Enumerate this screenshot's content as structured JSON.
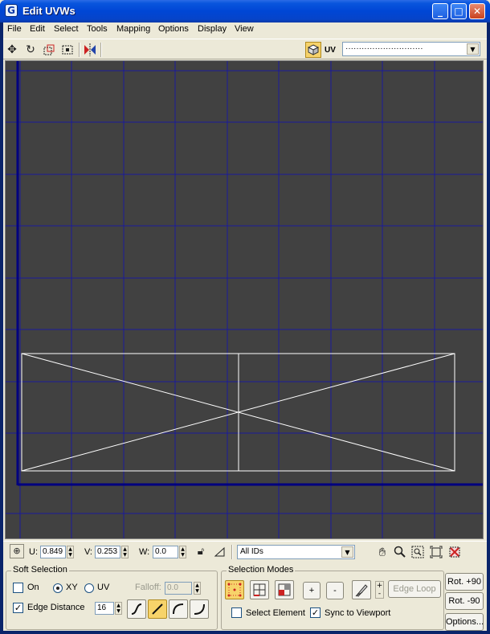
{
  "window": {
    "title": "Edit UVWs",
    "icon_letter": "G",
    "minimize_glyph": "_",
    "maximize_glyph": "□",
    "close_glyph": "✕"
  },
  "menu": {
    "items": [
      "File",
      "Edit",
      "Select",
      "Tools",
      "Mapping",
      "Options",
      "Display",
      "View"
    ]
  },
  "toolbar": {
    "uv_label": "UV",
    "texture_dropdown_value": "·····························",
    "icons": [
      "move-icon",
      "rotate-icon",
      "scale-icon",
      "freeform-icon",
      "mirror-icon",
      "texture-cube-icon"
    ]
  },
  "coords": {
    "u_label": "U:",
    "u_value": "0.849",
    "v_label": "V:",
    "v_value": "0.253",
    "w_label": "W:",
    "w_value": "0.0",
    "ids_value": "All IDs"
  },
  "soft_selection": {
    "title": "Soft Selection",
    "on_label": "On",
    "on_checked": false,
    "xy_label": "XY",
    "uv_label": "UV",
    "mode": "XY",
    "falloff_label": "Falloff:",
    "falloff_value": "0.0",
    "edge_distance_label": "Edge Distance",
    "edge_distance_checked": true,
    "edge_distance_value": "16"
  },
  "selection_modes": {
    "title": "Selection Modes",
    "plus_label": "+",
    "minus_label": "-",
    "edge_loop_label": "Edge Loop",
    "select_element_label": "Select Element",
    "select_element_checked": false,
    "sync_label": "Sync to Viewport",
    "sync_checked": true
  },
  "rotate": {
    "rot_plus_label": "Rot. +90",
    "rot_minus_label": "Rot. -90",
    "options_label": "Options..."
  },
  "colors": {
    "viewport_bg": "#414141",
    "grid_line": "#1a1a9a",
    "grid_axis": "#000080",
    "uv_edges": "#ffffff",
    "titlebar": "#0046d5",
    "selected_button": "#f7d36a"
  }
}
